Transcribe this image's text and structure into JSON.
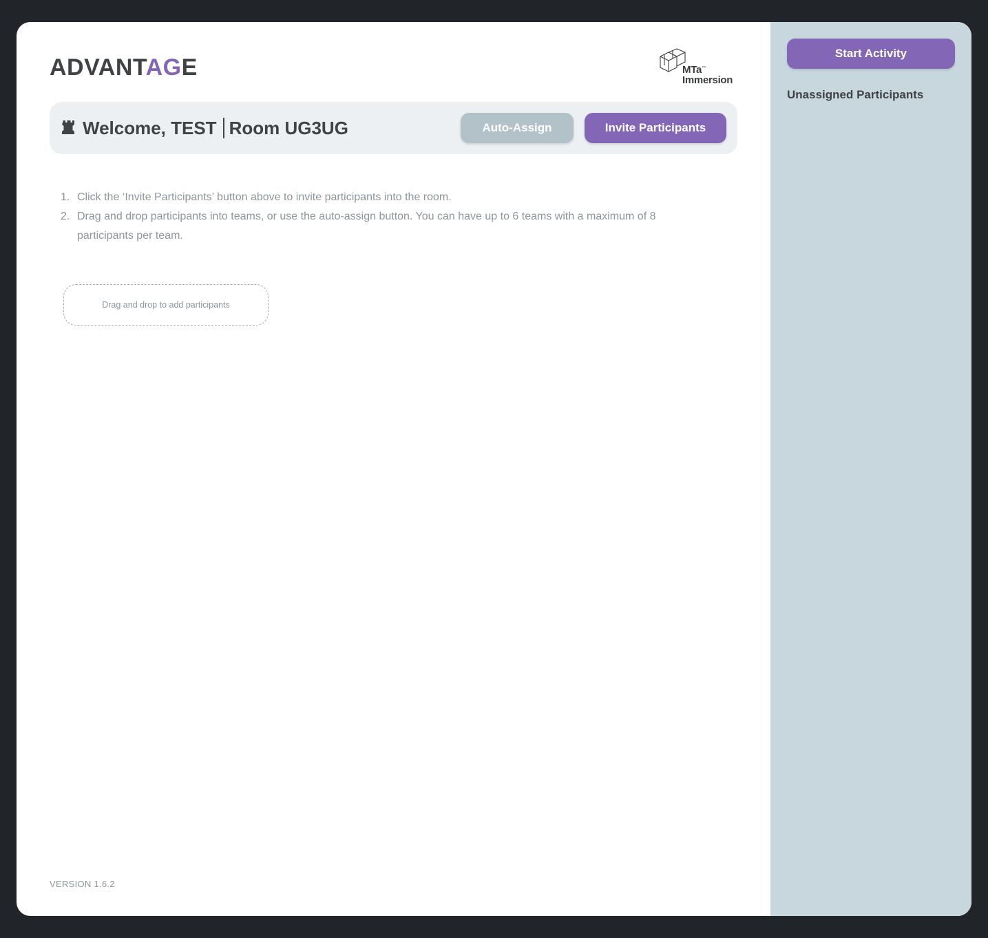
{
  "brand": {
    "part1": "ADVANT",
    "part2": "AG",
    "part3": "E"
  },
  "logo": {
    "line1": "MTa",
    "line2": "Immersion",
    "trademark": "™",
    "icon": "cube-outline-icon"
  },
  "header": {
    "room_icon": "chess-rook-icon",
    "welcome": "Welcome, TEST",
    "room": "Room UG3UG",
    "auto_assign_label": "Auto-Assign",
    "invite_label": "Invite Participants"
  },
  "instructions": [
    {
      "num": "1.",
      "text": "Click the ‘Invite Participants’ button above to invite participants into the room."
    },
    {
      "num": "2.",
      "text": "Drag and drop participants into teams, or use the auto-assign button. You can have up to 6 teams with a maximum of 8 participants per team."
    }
  ],
  "dropzone": {
    "label": "Drag and drop to add participants"
  },
  "version": "VERSION 1.6.2",
  "sidebar": {
    "start_label": "Start Activity",
    "unassigned_title": "Unassigned Participants"
  },
  "colors": {
    "accent": "#8366b5",
    "disabled_button": "#b3c2c9",
    "sidebar_bg": "#c8d7de",
    "text_dark": "#3f4346",
    "text_muted": "#8d969b",
    "page_bg": "#212429"
  }
}
